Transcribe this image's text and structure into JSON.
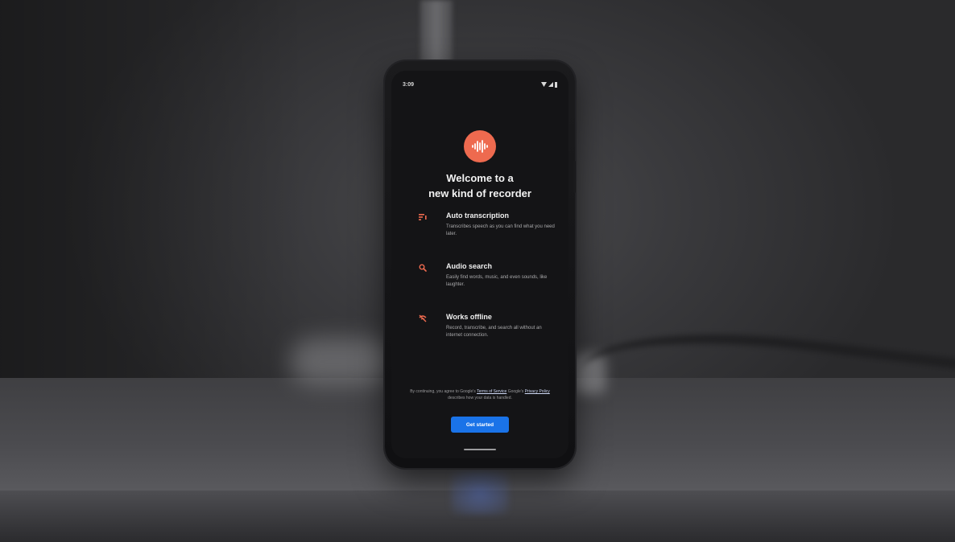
{
  "status_bar": {
    "time": "3:09",
    "icons": [
      "wifi-icon",
      "signal-icon",
      "battery-icon"
    ]
  },
  "app": {
    "icon": "waveform-icon",
    "accent_color": "#ee6a4f",
    "title_line1": "Welcome to a",
    "title_line2": "new kind of recorder"
  },
  "features": [
    {
      "icon": "transcription-icon",
      "title": "Auto transcription",
      "description": "Transcribes speech as you can find what you need later."
    },
    {
      "icon": "search-icon",
      "title": "Audio search",
      "description": "Easily find words, music, and even sounds, like laughter."
    },
    {
      "icon": "offline-icon",
      "title": "Works offline",
      "description": "Record, transcribe, and search all without an internet connection."
    }
  ],
  "legal": {
    "prefix": "By continuing, you agree to Google's",
    "terms_link": "Terms of Service",
    "middle": "Google's",
    "privacy_link": "Privacy Policy",
    "suffix": "describes how your data is handled."
  },
  "cta": {
    "label": "Get started",
    "color": "#1a73e8"
  }
}
